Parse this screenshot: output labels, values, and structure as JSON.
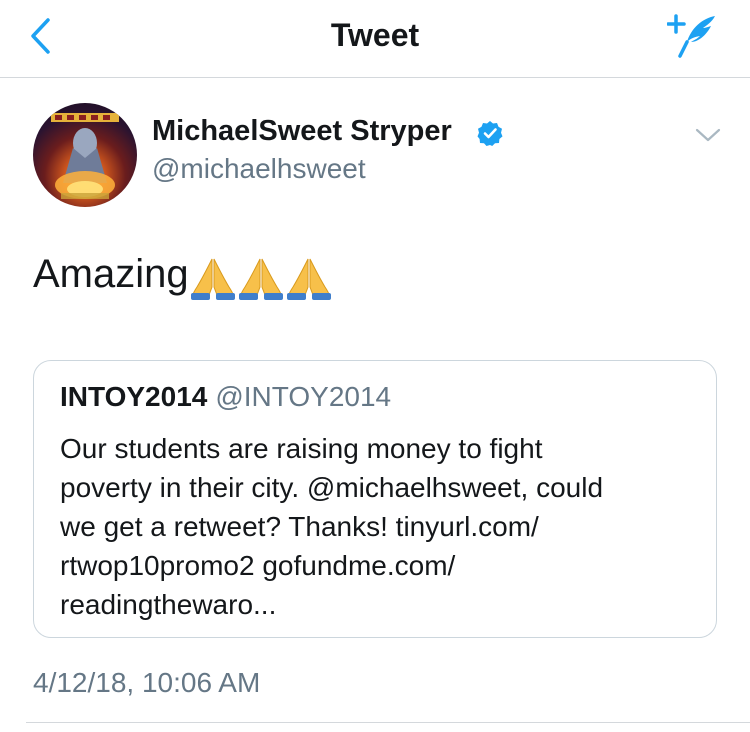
{
  "nav": {
    "title": "Tweet",
    "back_icon": "chevron-left-icon",
    "compose_icon": "compose-tweet-icon"
  },
  "tweet": {
    "display_name": "MichaelSweet Stryper",
    "handle": "@michaelhsweet",
    "verified": true,
    "text": "Amazing",
    "emojis": [
      "folded-hands",
      "folded-hands",
      "folded-hands"
    ],
    "timestamp": "4/12/18, 10:06 AM"
  },
  "quoted_tweet": {
    "display_name": "INTOY2014",
    "handle": "@INTOY2014",
    "text": "Our students are raising money to fight\npoverty in their city. @michaelhsweet, could\nwe get a retweet? Thanks! tinyurl.com/\nrtwop10promo2 gofundme.com/\nreadingthewaro..."
  },
  "colors": {
    "accent": "#1da1f2",
    "text_primary": "#14171a",
    "text_secondary": "#657786",
    "border": "#ccd6dd"
  }
}
